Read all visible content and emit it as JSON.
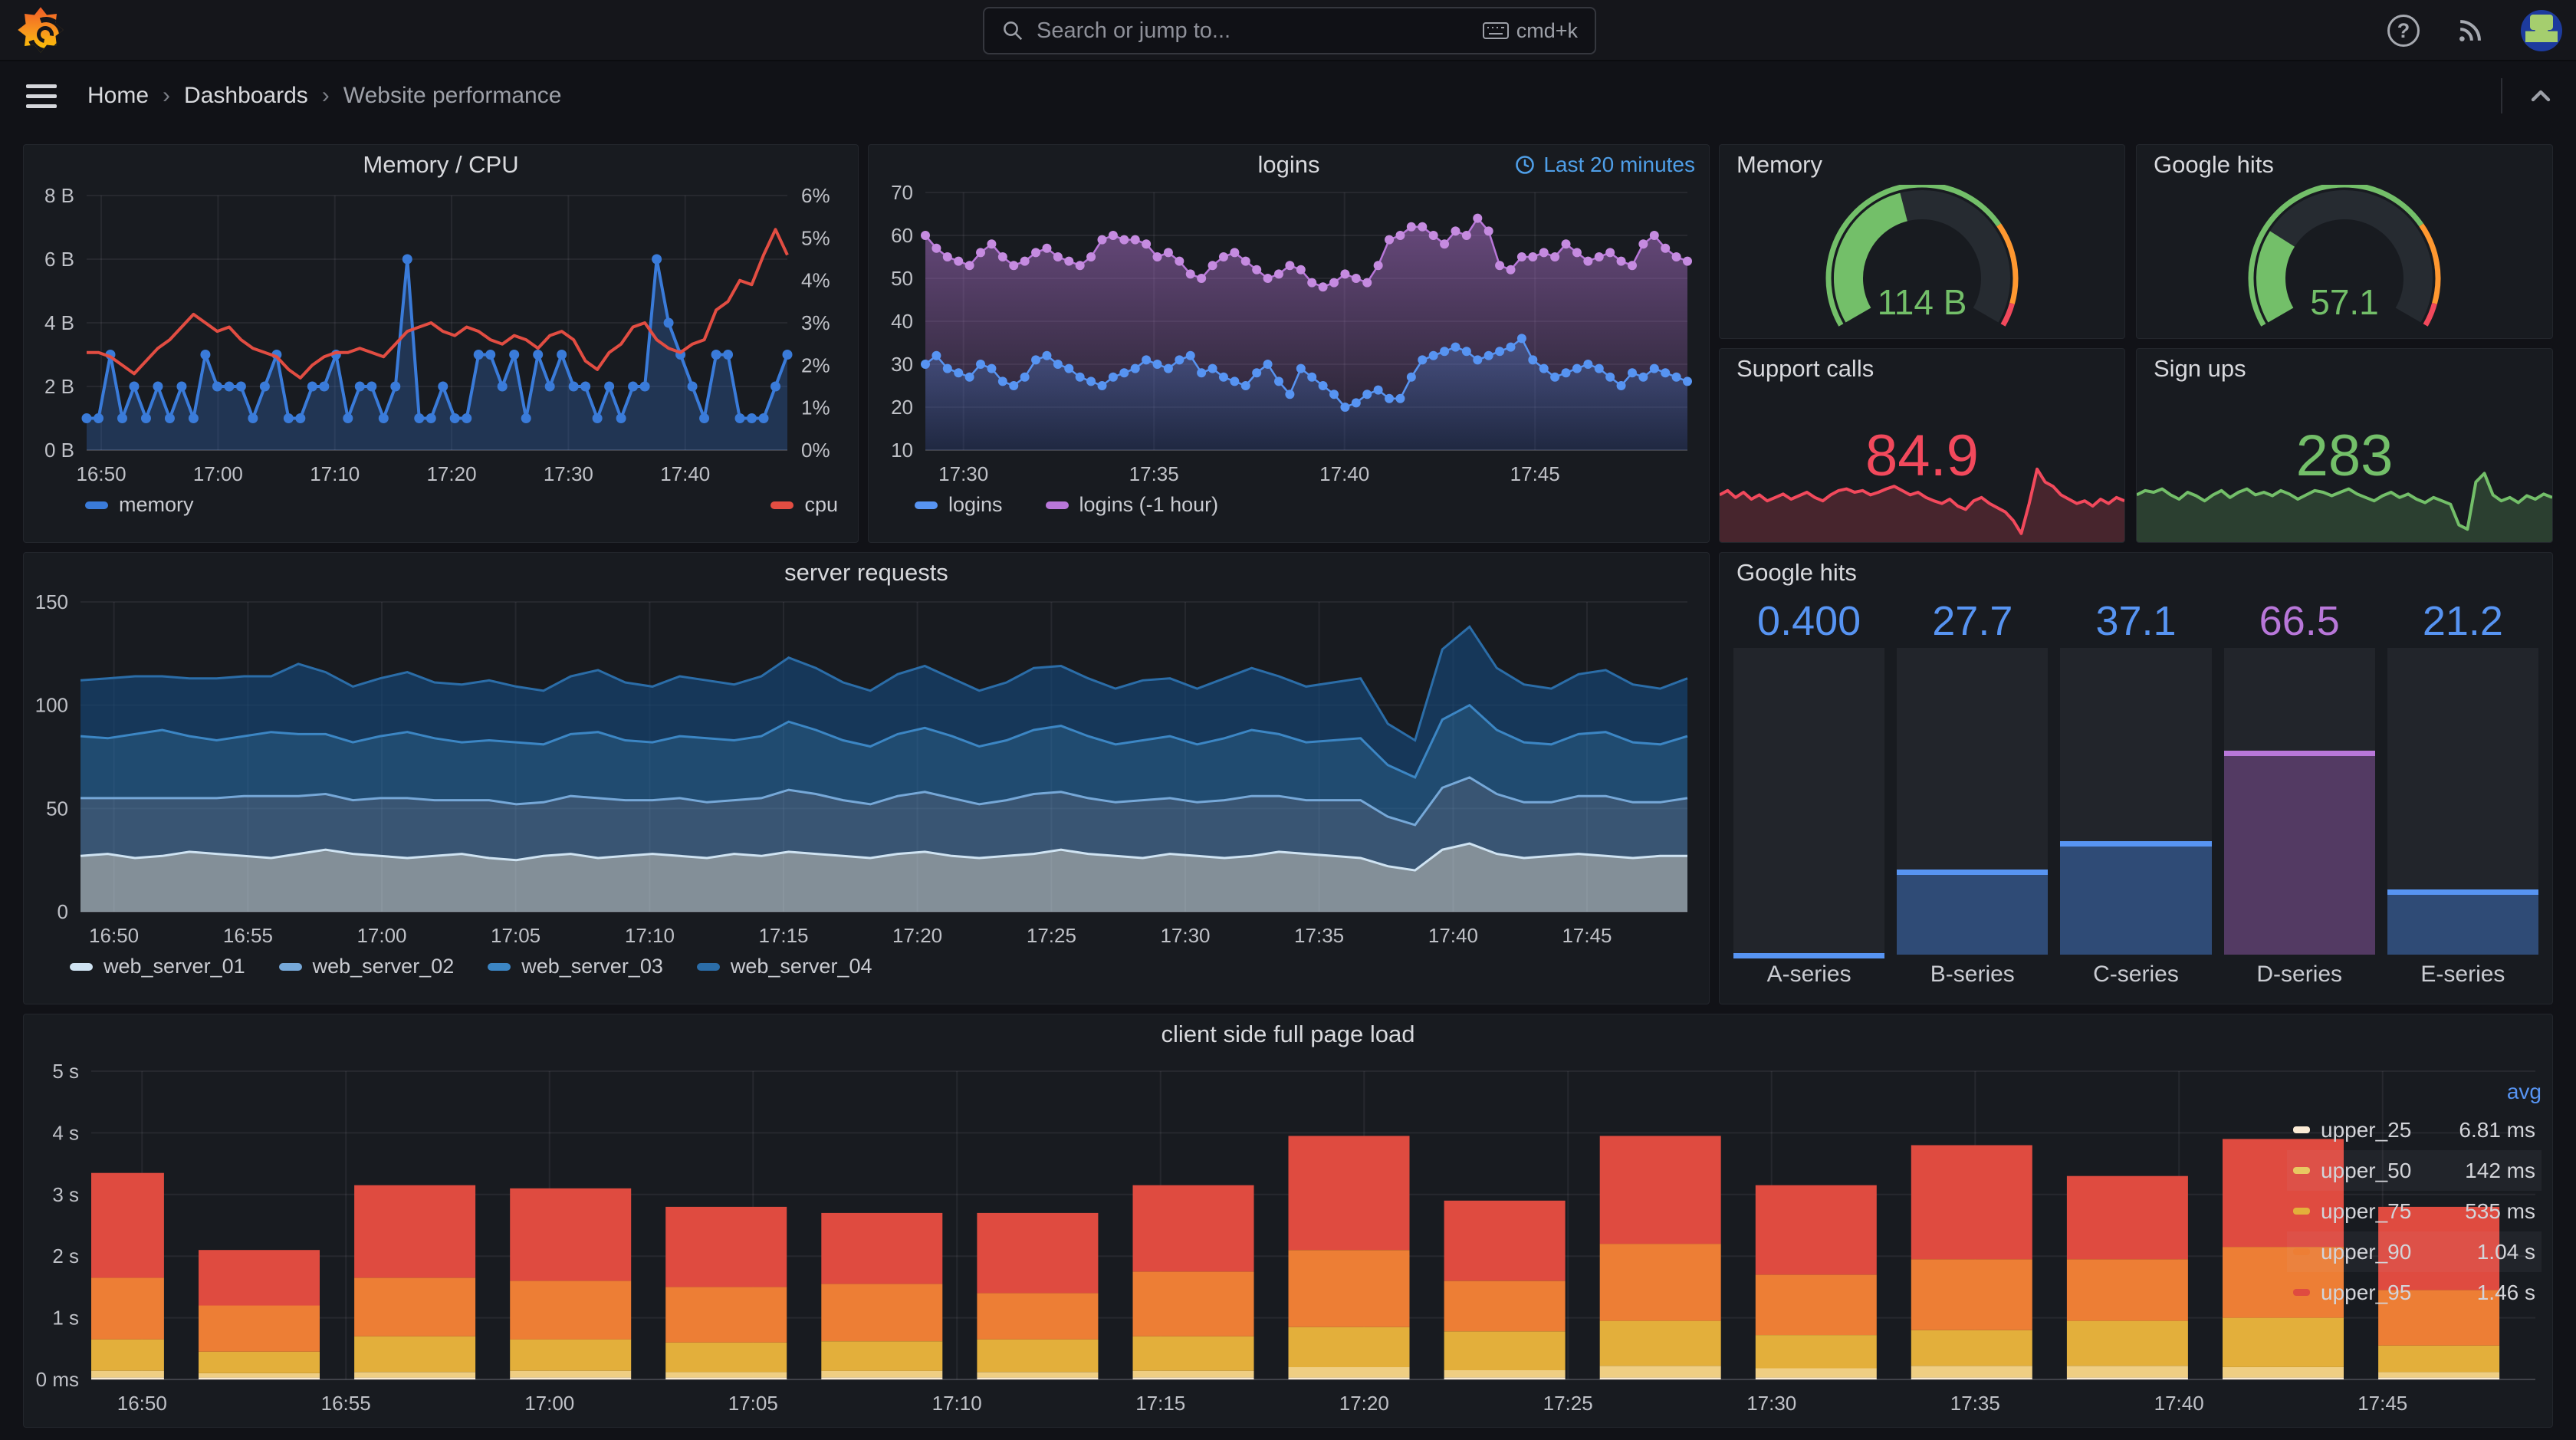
{
  "topnav": {
    "search_placeholder": "Search or jump to...",
    "shortcut_label": "cmd+k"
  },
  "breadcrumb": {
    "home": "Home",
    "dashboards": "Dashboards",
    "current": "Website performance",
    "separator": "›"
  },
  "icons": {
    "help": "?",
    "rss": "rss-icon",
    "avatar": "user-avatar",
    "kiosk": "chevron-up"
  },
  "colors": {
    "blue": "#5794F2",
    "dark_blue": "#3A7BD9",
    "red": "#E24D42",
    "crimson": "#F2495C",
    "purple": "#B877D9",
    "green": "#73BF69",
    "orange": "#FF9830",
    "panel_bg": "#181b20",
    "page_bg": "#111217"
  },
  "chart_data": [
    {
      "id": "memory_cpu",
      "type": "line",
      "title": "Memory / CPU",
      "y_left": {
        "min": 0,
        "max": 8,
        "tick_labels": [
          "0 B",
          "2 B",
          "4 B",
          "6 B",
          "8 B"
        ],
        "tick_values": [
          0,
          2,
          4,
          6,
          8
        ]
      },
      "y_right": {
        "min": 0,
        "max": 6,
        "tick_labels": [
          "0%",
          "1%",
          "2%",
          "3%",
          "4%",
          "5%",
          "6%"
        ],
        "tick_values": [
          0,
          1,
          2,
          3,
          4,
          5,
          6
        ]
      },
      "x_ticks": [
        {
          "label": "16:50",
          "f": 0.0208
        },
        {
          "label": "17:00",
          "f": 0.1875
        },
        {
          "label": "17:10",
          "f": 0.3542
        },
        {
          "label": "17:20",
          "f": 0.5208
        },
        {
          "label": "17:30",
          "f": 0.6875
        },
        {
          "label": "17:40",
          "f": 0.8542
        }
      ],
      "series": [
        {
          "name": "memory",
          "color": "#3A7BD9",
          "axis": "left",
          "dots": true,
          "fill": "rgba(58,123,217,0.28)",
          "values": [
            1,
            1,
            3,
            1,
            2,
            1,
            2,
            1,
            2,
            1,
            3,
            2,
            2,
            2,
            1,
            2,
            3,
            1,
            1,
            2,
            2,
            3,
            1,
            2,
            2,
            1,
            2,
            6,
            1,
            1,
            2,
            1,
            1,
            3,
            3,
            2,
            3,
            1,
            3,
            2,
            3,
            2,
            2,
            1,
            2,
            1,
            2,
            2,
            6,
            4,
            3,
            2,
            1,
            3,
            3,
            1,
            1,
            1,
            2,
            3
          ]
        },
        {
          "name": "cpu",
          "color": "#E24D42",
          "axis": "right",
          "dots": false,
          "fill": "none",
          "values": [
            2.3,
            2.3,
            2.2,
            2.0,
            1.8,
            2.1,
            2.4,
            2.6,
            2.9,
            3.2,
            3.0,
            2.8,
            2.9,
            2.6,
            2.4,
            2.3,
            2.2,
            1.9,
            1.7,
            2.0,
            2.2,
            2.3,
            2.3,
            2.4,
            2.3,
            2.2,
            2.5,
            2.8,
            2.9,
            3.0,
            2.8,
            2.7,
            2.9,
            2.8,
            2.6,
            2.5,
            2.7,
            2.6,
            2.4,
            2.7,
            2.8,
            2.6,
            2.1,
            1.9,
            2.3,
            2.5,
            2.9,
            3.0,
            2.6,
            2.4,
            2.3,
            2.5,
            2.6,
            3.3,
            3.5,
            4.0,
            3.9,
            4.6,
            5.2,
            4.6
          ]
        }
      ]
    },
    {
      "id": "logins",
      "type": "line",
      "title": "logins",
      "time_range": "Last 20 minutes",
      "y": {
        "min": 10,
        "max": 70,
        "tick_values": [
          10,
          20,
          30,
          40,
          50,
          60,
          70
        ]
      },
      "x_ticks": [
        {
          "label": "17:30",
          "f": 0.05
        },
        {
          "label": "17:35",
          "f": 0.3
        },
        {
          "label": "17:40",
          "f": 0.55
        },
        {
          "label": "17:45",
          "f": 0.8
        }
      ],
      "series": [
        {
          "name": "logins",
          "color": "#5794F2",
          "dots": true,
          "values": [
            30,
            32,
            29,
            28,
            27,
            30,
            29,
            26,
            25,
            27,
            31,
            32,
            30,
            29,
            27,
            26,
            25,
            27,
            28,
            29,
            31,
            30,
            29,
            31,
            32,
            28,
            29,
            27,
            26,
            25,
            28,
            30,
            26,
            23,
            29,
            27,
            25,
            23,
            20,
            21,
            23,
            24,
            22,
            22,
            27,
            31,
            32,
            33,
            34,
            33,
            31,
            32,
            33,
            34,
            36,
            31,
            29,
            27,
            28,
            29,
            30,
            29,
            27,
            25,
            28,
            27,
            29,
            28,
            27,
            26
          ]
        },
        {
          "name": "logins (-1 hour)",
          "color": "#B877D9",
          "dots": true,
          "values": [
            60,
            57,
            55,
            54,
            53,
            56,
            58,
            55,
            53,
            54,
            56,
            57,
            55,
            54,
            53,
            55,
            59,
            60,
            59,
            59,
            58,
            55,
            56,
            54,
            51,
            50,
            53,
            55,
            56,
            54,
            52,
            50,
            51,
            53,
            52,
            49,
            48,
            49,
            51,
            50,
            49,
            53,
            59,
            60,
            62,
            62,
            60,
            58,
            61,
            60,
            64,
            61,
            53,
            52,
            55,
            55,
            56,
            55,
            58,
            56,
            54,
            55,
            56,
            54,
            53,
            58,
            60,
            57,
            55,
            54
          ]
        }
      ]
    },
    {
      "id": "memory_gauge",
      "type": "gauge",
      "title": "Memory",
      "value": "114 B",
      "fraction": 0.44,
      "value_color": "#73BF69",
      "thresholds": [
        {
          "color": "#73BF69",
          "to": 0.73
        },
        {
          "color": "#FF9830",
          "to": 0.94
        },
        {
          "color": "#F2495C",
          "to": 1.0
        }
      ]
    },
    {
      "id": "google_gauge",
      "type": "gauge",
      "title": "Google hits",
      "value": "57.1",
      "fraction": 0.26,
      "value_color": "#73BF69",
      "thresholds": [
        {
          "color": "#73BF69",
          "to": 0.73
        },
        {
          "color": "#FF9830",
          "to": 0.94
        },
        {
          "color": "#F2495C",
          "to": 1.0
        }
      ]
    },
    {
      "id": "support_calls",
      "type": "stat",
      "title": "Support calls",
      "value": "84.9",
      "color": "#F2495C",
      "spark": [
        55,
        60,
        52,
        58,
        50,
        55,
        48,
        52,
        56,
        50,
        54,
        58,
        52,
        48,
        55,
        60,
        62,
        58,
        60,
        55,
        58,
        62,
        65,
        60,
        55,
        58,
        52,
        48,
        45,
        50,
        42,
        38,
        48,
        52,
        45,
        40,
        35,
        25,
        10,
        45,
        85,
        70,
        65,
        55,
        50,
        45,
        48,
        42,
        50,
        45,
        52,
        48
      ]
    },
    {
      "id": "sign_ups",
      "type": "stat",
      "title": "Sign ups",
      "value": "283",
      "color": "#73BF69",
      "spark": [
        55,
        60,
        58,
        62,
        55,
        50,
        58,
        54,
        48,
        55,
        60,
        52,
        58,
        62,
        55,
        58,
        54,
        60,
        56,
        50,
        55,
        60,
        58,
        54,
        58,
        62,
        56,
        52,
        48,
        54,
        58,
        52,
        56,
        50,
        46,
        52,
        48,
        44,
        20,
        15,
        70,
        80,
        55,
        48,
        52,
        46,
        54,
        50,
        56,
        52
      ]
    },
    {
      "id": "server_requests",
      "type": "stacked_area",
      "title": "server requests",
      "y": {
        "min": 0,
        "max": 150,
        "tick_values": [
          0,
          50,
          100,
          150
        ]
      },
      "x_ticks": [
        {
          "label": "16:50",
          "f": 0.0208
        },
        {
          "label": "16:55",
          "f": 0.1042
        },
        {
          "label": "17:00",
          "f": 0.1875
        },
        {
          "label": "17:05",
          "f": 0.2708
        },
        {
          "label": "17:10",
          "f": 0.3542
        },
        {
          "label": "17:15",
          "f": 0.4375
        },
        {
          "label": "17:20",
          "f": 0.5208
        },
        {
          "label": "17:25",
          "f": 0.6042
        },
        {
          "label": "17:30",
          "f": 0.6875
        },
        {
          "label": "17:35",
          "f": 0.7708
        },
        {
          "label": "17:40",
          "f": 0.8542
        },
        {
          "label": "17:45",
          "f": 0.9375
        }
      ],
      "series": [
        {
          "name": "web_server_01",
          "color": "#CFE3F2",
          "fill": "rgba(203,221,234,0.60)",
          "values": [
            27,
            28,
            26,
            27,
            29,
            28,
            27,
            26,
            28,
            30,
            28,
            27,
            26,
            27,
            28,
            26,
            25,
            27,
            28,
            26,
            27,
            28,
            27,
            26,
            28,
            27,
            29,
            28,
            27,
            26,
            28,
            29,
            27,
            26,
            27,
            28,
            30,
            28,
            27,
            26,
            28,
            27,
            26,
            27,
            29,
            28,
            27,
            26,
            22,
            20,
            30,
            33,
            28,
            26,
            27,
            28,
            27,
            26,
            27,
            27
          ]
        },
        {
          "name": "web_server_02",
          "color": "#76A8D8",
          "fill": "rgba(90,143,197,0.50)",
          "values": [
            28,
            27,
            29,
            28,
            26,
            27,
            29,
            30,
            28,
            27,
            26,
            28,
            29,
            27,
            26,
            28,
            27,
            26,
            28,
            29,
            27,
            26,
            28,
            27,
            26,
            28,
            30,
            29,
            27,
            26,
            28,
            29,
            28,
            26,
            27,
            29,
            28,
            27,
            26,
            28,
            27,
            26,
            28,
            29,
            27,
            26,
            27,
            28,
            24,
            22,
            30,
            32,
            29,
            27,
            26,
            28,
            29,
            27,
            26,
            28
          ]
        },
        {
          "name": "web_server_03",
          "color": "#3C86C4",
          "fill": "rgba(40,114,178,0.55)",
          "values": [
            30,
            29,
            31,
            33,
            30,
            28,
            29,
            31,
            30,
            29,
            28,
            30,
            32,
            30,
            28,
            29,
            30,
            28,
            30,
            32,
            29,
            28,
            30,
            31,
            29,
            30,
            33,
            31,
            29,
            28,
            30,
            31,
            30,
            28,
            29,
            31,
            32,
            30,
            28,
            29,
            30,
            28,
            30,
            32,
            30,
            28,
            29,
            30,
            25,
            23,
            33,
            35,
            31,
            29,
            28,
            30,
            31,
            29,
            28,
            30
          ]
        },
        {
          "name": "web_server_04",
          "color": "#2B6DA8",
          "fill": "rgba(21,70,120,0.65)",
          "values": [
            27,
            29,
            28,
            26,
            28,
            30,
            29,
            27,
            34,
            30,
            27,
            28,
            29,
            27,
            28,
            29,
            27,
            26,
            28,
            30,
            28,
            27,
            29,
            28,
            27,
            29,
            31,
            30,
            28,
            27,
            29,
            30,
            28,
            27,
            28,
            30,
            29,
            28,
            27,
            29,
            28,
            27,
            29,
            30,
            28,
            27,
            28,
            29,
            20,
            18,
            34,
            38,
            30,
            28,
            27,
            29,
            30,
            28,
            27,
            28
          ]
        }
      ]
    },
    {
      "id": "google_bars",
      "type": "bar_gauge",
      "title": "Google hits",
      "max": 100,
      "bars": [
        {
          "label": "A-series",
          "value": "0.400",
          "v": 0.4,
          "color": "#5794F2",
          "fill": "#2F4B76"
        },
        {
          "label": "B-series",
          "value": "27.7",
          "v": 27.7,
          "color": "#5794F2",
          "fill": "#2F4B76"
        },
        {
          "label": "C-series",
          "value": "37.1",
          "v": 37.1,
          "color": "#5794F2",
          "fill": "#2F4B76"
        },
        {
          "label": "D-series",
          "value": "66.5",
          "v": 66.5,
          "color": "#B877D9",
          "fill": "#533A63"
        },
        {
          "label": "E-series",
          "value": "21.2",
          "v": 21.2,
          "color": "#5794F2",
          "fill": "#2F4B76"
        }
      ]
    },
    {
      "id": "client_load",
      "type": "stacked_bar",
      "title": "client side full page load",
      "y": {
        "max": 5,
        "tick_labels": [
          "0 ms",
          "1 s",
          "2 s",
          "3 s",
          "4 s",
          "5 s"
        ],
        "tick_values": [
          0,
          1,
          2,
          3,
          4,
          5
        ]
      },
      "x_ticks": [
        {
          "label": "16:50",
          "f": 0.0208
        },
        {
          "label": "16:55",
          "f": 0.1042
        },
        {
          "label": "17:00",
          "f": 0.1875
        },
        {
          "label": "17:05",
          "f": 0.2708
        },
        {
          "label": "17:10",
          "f": 0.3542
        },
        {
          "label": "17:15",
          "f": 0.4375
        },
        {
          "label": "17:20",
          "f": 0.5208
        },
        {
          "label": "17:25",
          "f": 0.6042
        },
        {
          "label": "17:30",
          "f": 0.6875
        },
        {
          "label": "17:35",
          "f": 0.7708
        },
        {
          "label": "17:40",
          "f": 0.8542
        },
        {
          "label": "17:45",
          "f": 0.9375
        }
      ],
      "seg_colors": [
        "#FBEBD5",
        "#EFCE83",
        "#E3AF3B",
        "#ED7E35",
        "#DF4B40"
      ],
      "bars": [
        [
          0.03,
          0.14,
          0.65,
          1.65,
          3.35
        ],
        [
          0.03,
          0.1,
          0.45,
          1.2,
          2.1
        ],
        [
          0.03,
          0.12,
          0.7,
          1.65,
          3.15
        ],
        [
          0.03,
          0.14,
          0.65,
          1.6,
          3.1
        ],
        [
          0.03,
          0.12,
          0.6,
          1.5,
          2.8
        ],
        [
          0.03,
          0.14,
          0.62,
          1.55,
          2.7
        ],
        [
          0.03,
          0.12,
          0.65,
          1.4,
          2.7
        ],
        [
          0.03,
          0.14,
          0.7,
          1.75,
          3.15
        ],
        [
          0.03,
          0.2,
          0.85,
          2.1,
          3.95
        ],
        [
          0.03,
          0.15,
          0.78,
          1.6,
          2.9
        ],
        [
          0.03,
          0.22,
          0.95,
          2.2,
          3.95
        ],
        [
          0.03,
          0.18,
          0.72,
          1.7,
          3.15
        ],
        [
          0.03,
          0.22,
          0.8,
          1.95,
          3.8
        ],
        [
          0.03,
          0.22,
          0.95,
          1.95,
          3.3
        ],
        [
          0.03,
          0.2,
          1.0,
          2.15,
          3.9
        ],
        [
          0.03,
          0.12,
          0.55,
          1.45,
          2.8
        ]
      ],
      "legend": {
        "header": "avg",
        "rows": [
          {
            "name": "upper_25",
            "value": "6.81 ms",
            "color": "#FBEBD5"
          },
          {
            "name": "upper_50",
            "value": "142 ms",
            "color": "#E8C862"
          },
          {
            "name": "upper_75",
            "value": "535 ms",
            "color": "#E3AF3B"
          },
          {
            "name": "upper_90",
            "value": "1.04 s",
            "color": "#ED7E35"
          },
          {
            "name": "upper_95",
            "value": "1.46 s",
            "color": "#DF4B40"
          }
        ]
      }
    }
  ]
}
